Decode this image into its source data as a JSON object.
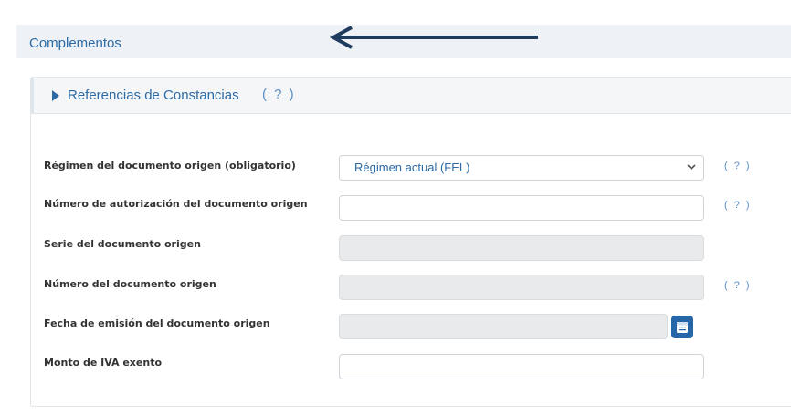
{
  "section": {
    "title": "Complementos"
  },
  "panel": {
    "title": "Referencias de Constancias",
    "help": "( ? )"
  },
  "fields": [
    {
      "label": "Régimen del documento origen (obligatorio)",
      "value": "Régimen actual (FEL)",
      "help": "( ? )"
    },
    {
      "label": "Número de autorización del documento origen",
      "value": "",
      "help": "( ? )"
    },
    {
      "label": "Serie del documento origen",
      "value": ""
    },
    {
      "label": "Número del documento origen",
      "value": "",
      "help": "( ? )"
    },
    {
      "label": "Fecha de emisión del documento origen",
      "value": ""
    },
    {
      "label": "Monto de IVA exento",
      "value": ""
    }
  ],
  "icons": {
    "collapse": "caret-right-icon",
    "select": "chevron-down-icon",
    "calendar": "calendar-icon",
    "annotation": "arrow-left-icon"
  },
  "colors": {
    "accent": "#2d6aa3",
    "button": "#2466a8",
    "arrow": "#1f3c5e"
  }
}
